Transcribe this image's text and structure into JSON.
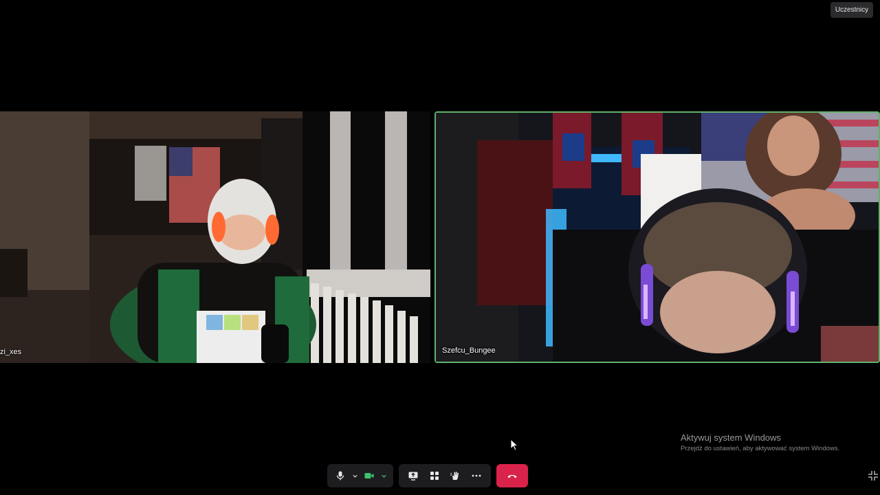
{
  "header": {
    "participants_label": "Uczestnicy"
  },
  "tiles": [
    {
      "name": "zi_xes",
      "active_speaker": false
    },
    {
      "name": "Szefcu_Bungee",
      "active_speaker": true
    }
  ],
  "watermark": {
    "title": "Aktywuj system Windows",
    "subtitle": "Przejdź do ustawień, aby aktywować system Windows."
  },
  "toolbar": {
    "buttons": [
      "mic-icon",
      "chevron-down-icon",
      "camera-icon",
      "chevron-down-icon",
      "share-screen-icon",
      "apps-icon",
      "raise-hand-icon",
      "more-icon",
      "hang-up-icon"
    ],
    "camera_color": "#3cc36f",
    "hangup_color": "#d9234a"
  },
  "colors": {
    "active_border": "#5fb36b",
    "background": "#000000"
  }
}
